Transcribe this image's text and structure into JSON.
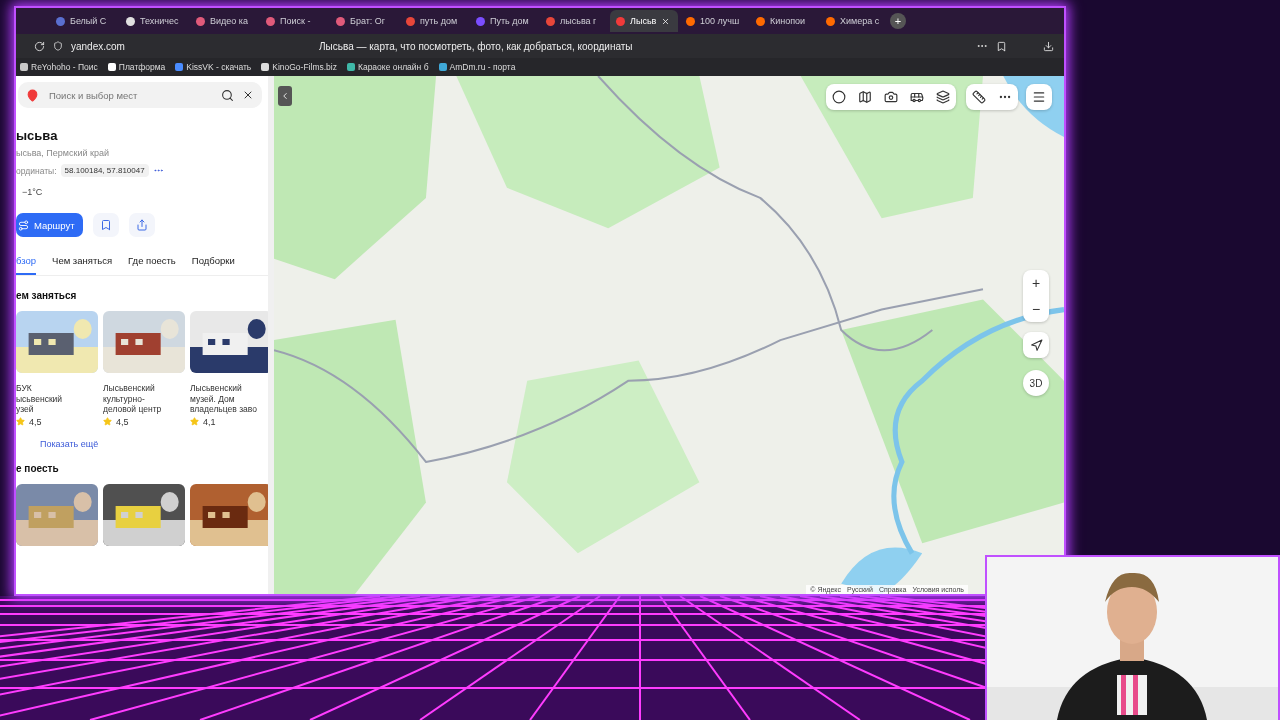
{
  "browser": {
    "tabs": [
      {
        "label": "Белый С",
        "selected": false,
        "color": "#5a6fd0"
      },
      {
        "label": "Техничес",
        "selected": false,
        "color": "#e0e0e0"
      },
      {
        "label": "Видео ка",
        "selected": false,
        "color": "#e05a7a"
      },
      {
        "label": "Поиск - ",
        "selected": false,
        "color": "#e05a7a"
      },
      {
        "label": "Брат: Ог",
        "selected": false,
        "color": "#e05a7a"
      },
      {
        "label": "путь дом",
        "selected": false,
        "color": "#e8463a"
      },
      {
        "label": "Путь дом",
        "selected": false,
        "color": "#7b4dff"
      },
      {
        "label": "лысьва г",
        "selected": false,
        "color": "#e8463a"
      },
      {
        "label": "Лысьв",
        "selected": true,
        "color": "#f03a3a"
      },
      {
        "label": "100 лучш",
        "selected": false,
        "color": "#ff6a00"
      },
      {
        "label": "Кинопои",
        "selected": false,
        "color": "#ff6a00"
      },
      {
        "label": "Химера с",
        "selected": false,
        "color": "#ff6a00"
      }
    ],
    "new_tab": "+",
    "address": "yandex.com",
    "page_title": "Лысьва — карта, что посмотреть, фото, как добраться, координаты",
    "bookmarks": [
      {
        "label": "ReYohoho - Поис",
        "color": "#c8c8c8"
      },
      {
        "label": "Платформа",
        "color": "#ffffff"
      },
      {
        "label": "KissVK - скачать",
        "color": "#4a8cff"
      },
      {
        "label": "KinoGo-Films.biz",
        "color": "#dddddd"
      },
      {
        "label": "Караоке онлайн б",
        "color": "#3fb8a8"
      },
      {
        "label": "AmDm.ru - порта",
        "color": "#3fa8d8"
      }
    ]
  },
  "sidebar": {
    "search": {
      "placeholder": "Поиск и выбор мест"
    },
    "title": "ысьва",
    "subtitle": "ысьва, Пермский край",
    "coords_label": "ординаты:",
    "coords": "58.100184, 57.810047",
    "temperature": "−1°C",
    "route_button": "Маршрут",
    "tabs": [
      {
        "label": "бзор",
        "selected": true
      },
      {
        "label": "Чем заняться",
        "selected": false
      },
      {
        "label": "Где поесть",
        "selected": false
      },
      {
        "label": "Подборки",
        "selected": false
      }
    ],
    "sections": [
      {
        "title": "ем заняться",
        "cards": [
          {
            "kind": "place",
            "name": "БУК\nысьвенский\nузей",
            "rating": "4,5"
          },
          {
            "kind": "place",
            "name": "Лысьвенский\nкультурно-\nделовой центр",
            "rating": "4,5"
          },
          {
            "kind": "place",
            "name": "Лысьвенский\nмузей. Дом\nвладельцев заво",
            "rating": "4,1"
          }
        ],
        "more": "Показать ещё"
      },
      {
        "title": "е поесть"
      }
    ]
  },
  "map": {
    "kind": "picture",
    "zoom_in": "+",
    "zoom_out": "−",
    "three_d": "3D",
    "attribution": [
      "© Яндекс",
      "Русский",
      "Справка",
      "Условия исполь"
    ]
  }
}
